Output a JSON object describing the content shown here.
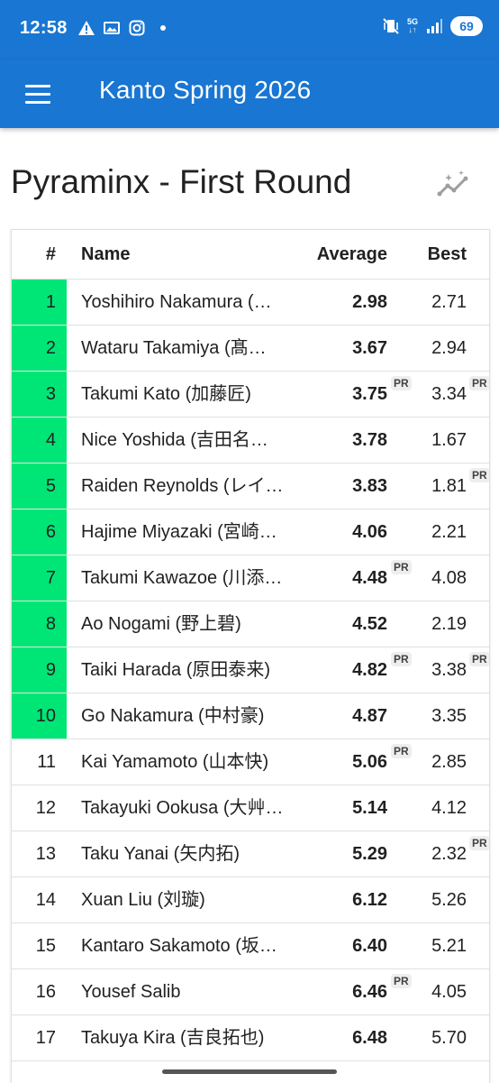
{
  "status_bar": {
    "time": "12:58",
    "network": "5G",
    "battery": "69",
    "icons": [
      "warning-icon",
      "photo-icon",
      "instagram-icon",
      "notification-dot-icon",
      "vibrate-icon",
      "signal-icon"
    ]
  },
  "app_bar": {
    "title": "Kanto Spring 2026",
    "menu_icon": "hamburger-menu-icon"
  },
  "page": {
    "title": "Pyraminx - First Round",
    "insights_icon": "chart-sparkle-icon"
  },
  "table": {
    "columns": {
      "rank": "#",
      "name": "Name",
      "average": "Average",
      "best": "Best"
    },
    "pr_label": "PR",
    "advancing_color": "#00e676",
    "rows": [
      {
        "rank": "1",
        "name": "Yoshihiro Nakamura (…",
        "average": "2.98",
        "best": "2.71",
        "advancing": true,
        "avg_pr": false,
        "best_pr": false
      },
      {
        "rank": "2",
        "name": "Wataru Takamiya (髙…",
        "average": "3.67",
        "best": "2.94",
        "advancing": true,
        "avg_pr": false,
        "best_pr": false
      },
      {
        "rank": "3",
        "name": "Takumi Kato (加藤匠)",
        "average": "3.75",
        "best": "3.34",
        "advancing": true,
        "avg_pr": true,
        "best_pr": true
      },
      {
        "rank": "4",
        "name": "Nice Yoshida (吉田名…",
        "average": "3.78",
        "best": "1.67",
        "advancing": true,
        "avg_pr": false,
        "best_pr": false
      },
      {
        "rank": "5",
        "name": "Raiden Reynolds (レイ…",
        "average": "3.83",
        "best": "1.81",
        "advancing": true,
        "avg_pr": false,
        "best_pr": true
      },
      {
        "rank": "6",
        "name": "Hajime Miyazaki (宮崎…",
        "average": "4.06",
        "best": "2.21",
        "advancing": true,
        "avg_pr": false,
        "best_pr": false
      },
      {
        "rank": "7",
        "name": "Takumi Kawazoe (川添…",
        "average": "4.48",
        "best": "4.08",
        "advancing": true,
        "avg_pr": true,
        "best_pr": false
      },
      {
        "rank": "8",
        "name": "Ao Nogami (野上碧)",
        "average": "4.52",
        "best": "2.19",
        "advancing": true,
        "avg_pr": false,
        "best_pr": false
      },
      {
        "rank": "9",
        "name": "Taiki Harada (原田泰来)",
        "average": "4.82",
        "best": "3.38",
        "advancing": true,
        "avg_pr": true,
        "best_pr": true
      },
      {
        "rank": "10",
        "name": "Go Nakamura (中村豪)",
        "average": "4.87",
        "best": "3.35",
        "advancing": true,
        "avg_pr": false,
        "best_pr": false
      },
      {
        "rank": "11",
        "name": "Kai Yamamoto (山本快)",
        "average": "5.06",
        "best": "2.85",
        "advancing": false,
        "avg_pr": true,
        "best_pr": false
      },
      {
        "rank": "12",
        "name": "Takayuki Ookusa (大艸…",
        "average": "5.14",
        "best": "4.12",
        "advancing": false,
        "avg_pr": false,
        "best_pr": false
      },
      {
        "rank": "13",
        "name": "Taku Yanai (矢内拓)",
        "average": "5.29",
        "best": "2.32",
        "advancing": false,
        "avg_pr": false,
        "best_pr": true
      },
      {
        "rank": "14",
        "name": "Xuan Liu (刘璇)",
        "average": "6.12",
        "best": "5.26",
        "advancing": false,
        "avg_pr": false,
        "best_pr": false
      },
      {
        "rank": "15",
        "name": "Kantaro Sakamoto (坂…",
        "average": "6.40",
        "best": "5.21",
        "advancing": false,
        "avg_pr": false,
        "best_pr": false
      },
      {
        "rank": "16",
        "name": "Yousef Salib",
        "average": "6.46",
        "best": "4.05",
        "advancing": false,
        "avg_pr": true,
        "best_pr": false
      },
      {
        "rank": "17",
        "name": "Takuya Kira (吉良拓也)",
        "average": "6.48",
        "best": "5.70",
        "advancing": false,
        "avg_pr": false,
        "best_pr": false
      }
    ]
  }
}
